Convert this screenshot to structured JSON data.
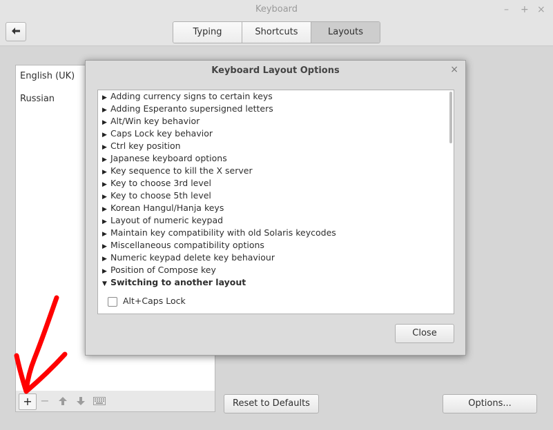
{
  "window": {
    "title": "Keyboard",
    "controls": {
      "minimize": "–",
      "maximize": "+",
      "close": "×"
    }
  },
  "toolbar": {
    "back_icon": "arrow-left-icon",
    "tabs": [
      {
        "label": "Typing",
        "active": false
      },
      {
        "label": "Shortcuts",
        "active": false
      },
      {
        "label": "Layouts",
        "active": true
      }
    ]
  },
  "layouts": {
    "items": [
      "English (UK)",
      "Russian"
    ],
    "buttons": {
      "add": "+",
      "remove": "−",
      "move_up": "arrow-up-icon",
      "move_down": "arrow-down-icon",
      "keyboard": "keyboard-icon"
    }
  },
  "buttons": {
    "reset": "Reset to Defaults",
    "options": "Options..."
  },
  "dialog": {
    "title": "Keyboard Layout Options",
    "close_icon": "×",
    "options": [
      "Adding currency signs to certain keys",
      "Adding Esperanto supersigned letters",
      "Alt/Win key behavior",
      "Caps Lock key behavior",
      "Ctrl key position",
      "Japanese keyboard options",
      "Key sequence to kill the X server",
      "Key to choose 3rd level",
      "Key to choose 5th level",
      "Korean Hangul/Hanja keys",
      "Layout of numeric keypad",
      "Maintain key compatibility with old Solaris keycodes",
      "Miscellaneous compatibility options",
      "Numeric keypad delete key behaviour",
      "Position of Compose key"
    ],
    "expanded_option": "Switching to another layout",
    "sub_option": {
      "label": "Alt+Caps Lock",
      "checked": false
    },
    "close_button": "Close"
  },
  "annotation": {
    "color": "#ff0000",
    "shape": "hand-drawn arrow pointing to add button"
  }
}
